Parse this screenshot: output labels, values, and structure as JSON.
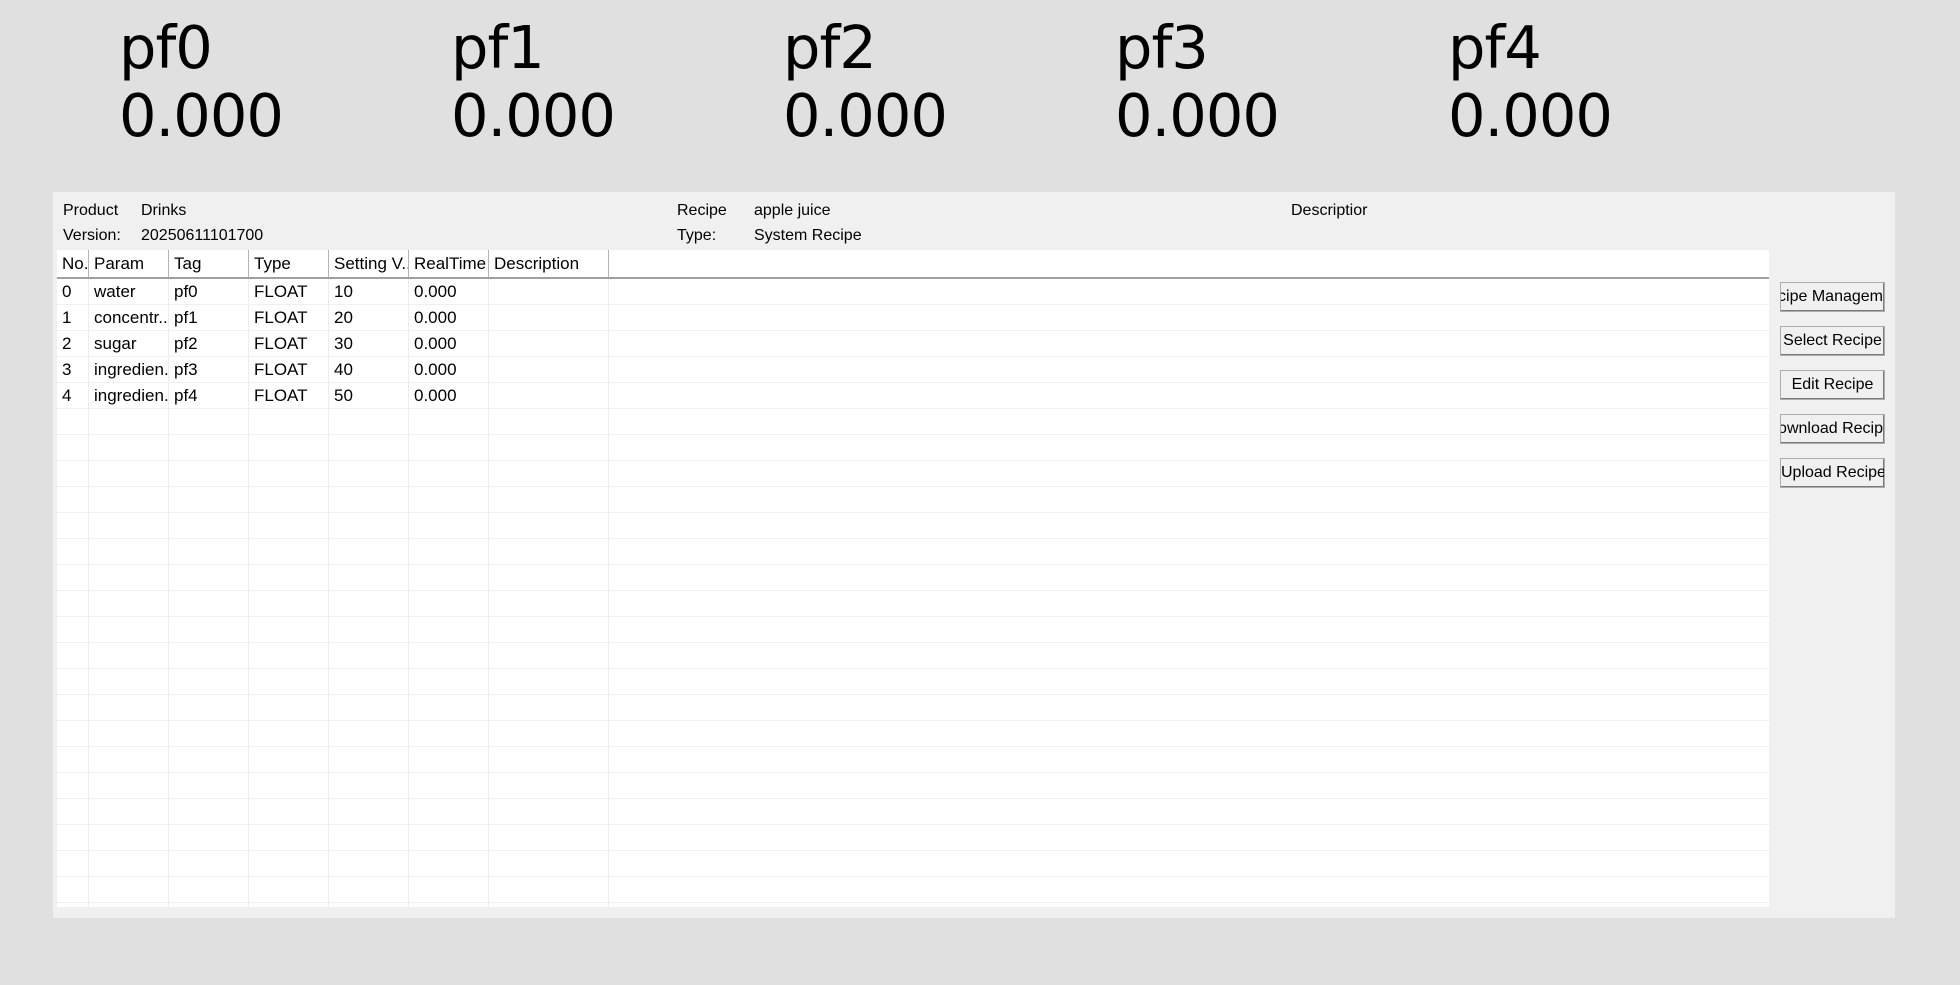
{
  "tiles": [
    {
      "name": "pf0",
      "value": "0.000"
    },
    {
      "name": "pf1",
      "value": "0.000"
    },
    {
      "name": "pf2",
      "value": "0.000"
    },
    {
      "name": "pf3",
      "value": "0.000"
    },
    {
      "name": "pf4",
      "value": "0.000"
    }
  ],
  "info": {
    "product_label": "Product",
    "product_value": "Drinks",
    "version_label": "Version:",
    "version_value": "20250611101700",
    "recipe_label": "Recipe",
    "recipe_value": "apple juice",
    "type_label": "Type:",
    "type_value": "System Recipe",
    "description_label": "Descriptior"
  },
  "table": {
    "columns": [
      "No.",
      "Param",
      "Tag",
      "Type",
      "Setting V...",
      "RealTime ...",
      "Description"
    ],
    "rows": [
      [
        "0",
        "water",
        "pf0",
        "FLOAT",
        "10",
        "0.000",
        ""
      ],
      [
        "1",
        "concentr...",
        "pf1",
        "FLOAT",
        "20",
        "0.000",
        ""
      ],
      [
        "2",
        "sugar",
        "pf2",
        "FLOAT",
        "30",
        "0.000",
        ""
      ],
      [
        "3",
        "ingredien...",
        "pf3",
        "FLOAT",
        "40",
        "0.000",
        ""
      ],
      [
        "4",
        "ingredien...",
        "pf4",
        "FLOAT",
        "50",
        "0.000",
        ""
      ],
      [
        "",
        "",
        "",
        "",
        "",
        "",
        ""
      ],
      [
        "",
        "",
        "",
        "",
        "",
        "",
        ""
      ],
      [
        "",
        "",
        "",
        "",
        "",
        "",
        ""
      ],
      [
        "",
        "",
        "",
        "",
        "",
        "",
        ""
      ],
      [
        "",
        "",
        "",
        "",
        "",
        "",
        ""
      ],
      [
        "",
        "",
        "",
        "",
        "",
        "",
        ""
      ],
      [
        "",
        "",
        "",
        "",
        "",
        "",
        ""
      ],
      [
        "",
        "",
        "",
        "",
        "",
        "",
        ""
      ],
      [
        "",
        "",
        "",
        "",
        "",
        "",
        ""
      ],
      [
        "",
        "",
        "",
        "",
        "",
        "",
        ""
      ],
      [
        "",
        "",
        "",
        "",
        "",
        "",
        ""
      ],
      [
        "",
        "",
        "",
        "",
        "",
        "",
        ""
      ],
      [
        "",
        "",
        "",
        "",
        "",
        "",
        ""
      ],
      [
        "",
        "",
        "",
        "",
        "",
        "",
        ""
      ],
      [
        "",
        "",
        "",
        "",
        "",
        "",
        ""
      ],
      [
        "",
        "",
        "",
        "",
        "",
        "",
        ""
      ],
      [
        "",
        "",
        "",
        "",
        "",
        "",
        ""
      ],
      [
        "",
        "",
        "",
        "",
        "",
        "",
        ""
      ],
      [
        "",
        "",
        "",
        "",
        "",
        "",
        ""
      ],
      [
        "",
        "",
        "",
        "",
        "",
        "",
        ""
      ]
    ]
  },
  "buttons": {
    "recipe_management": "cipe Managem",
    "select_recipe": "Select Recipe",
    "edit_recipe": "Edit Recipe",
    "download_recipe": "ownload Recip",
    "upload_recipe": "Upload Recipe"
  }
}
